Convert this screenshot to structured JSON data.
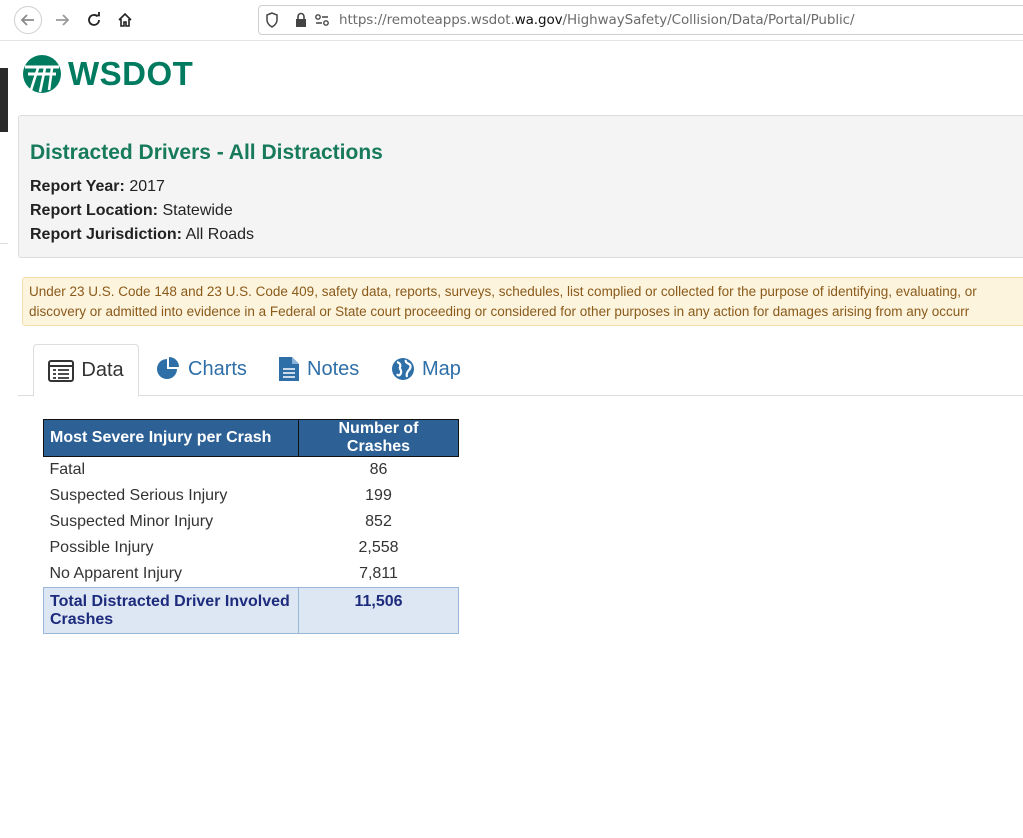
{
  "browser": {
    "url_prefix": "https://remoteapps.wsdot.",
    "url_domain": "wa.gov",
    "url_path": "/HighwaySafety/Collision/Data/Portal/Public/"
  },
  "brand": {
    "logo_text": "WSDOT",
    "color": "#007b5f"
  },
  "report": {
    "title": "Distracted Drivers - All Distractions",
    "year_label": "Report Year:",
    "year": "2017",
    "location_label": "Report Location:",
    "location": "Statewide",
    "jurisdiction_label": "Report Jurisdiction:",
    "jurisdiction": "All Roads"
  },
  "notice": {
    "line1": "Under 23 U.S. Code 148 and 23 U.S. Code 409, safety data, reports, surveys, schedules, list complied or collected for the purpose of identifying, evaluating, or",
    "line2": "discovery or admitted into evidence in a Federal or State court proceeding or considered for other purposes in any action for damages arising from any occurr"
  },
  "tabs": [
    {
      "label": "Data",
      "icon": "table-icon",
      "active": true
    },
    {
      "label": "Charts",
      "icon": "pie-chart-icon",
      "active": false
    },
    {
      "label": "Notes",
      "icon": "document-icon",
      "active": false
    },
    {
      "label": "Map",
      "icon": "globe-icon",
      "active": false
    }
  ],
  "table": {
    "headers": [
      "Most Severe Injury per Crash",
      "Number of Crashes"
    ],
    "rows": [
      {
        "label": "Fatal",
        "value": "86"
      },
      {
        "label": "Suspected Serious Injury",
        "value": "199"
      },
      {
        "label": "Suspected Minor Injury",
        "value": "852"
      },
      {
        "label": "Possible Injury",
        "value": "2,558"
      },
      {
        "label": "No Apparent Injury",
        "value": "7,811"
      }
    ],
    "total": {
      "label": "Total Distracted Driver Involved Crashes",
      "value": "11,506"
    }
  }
}
